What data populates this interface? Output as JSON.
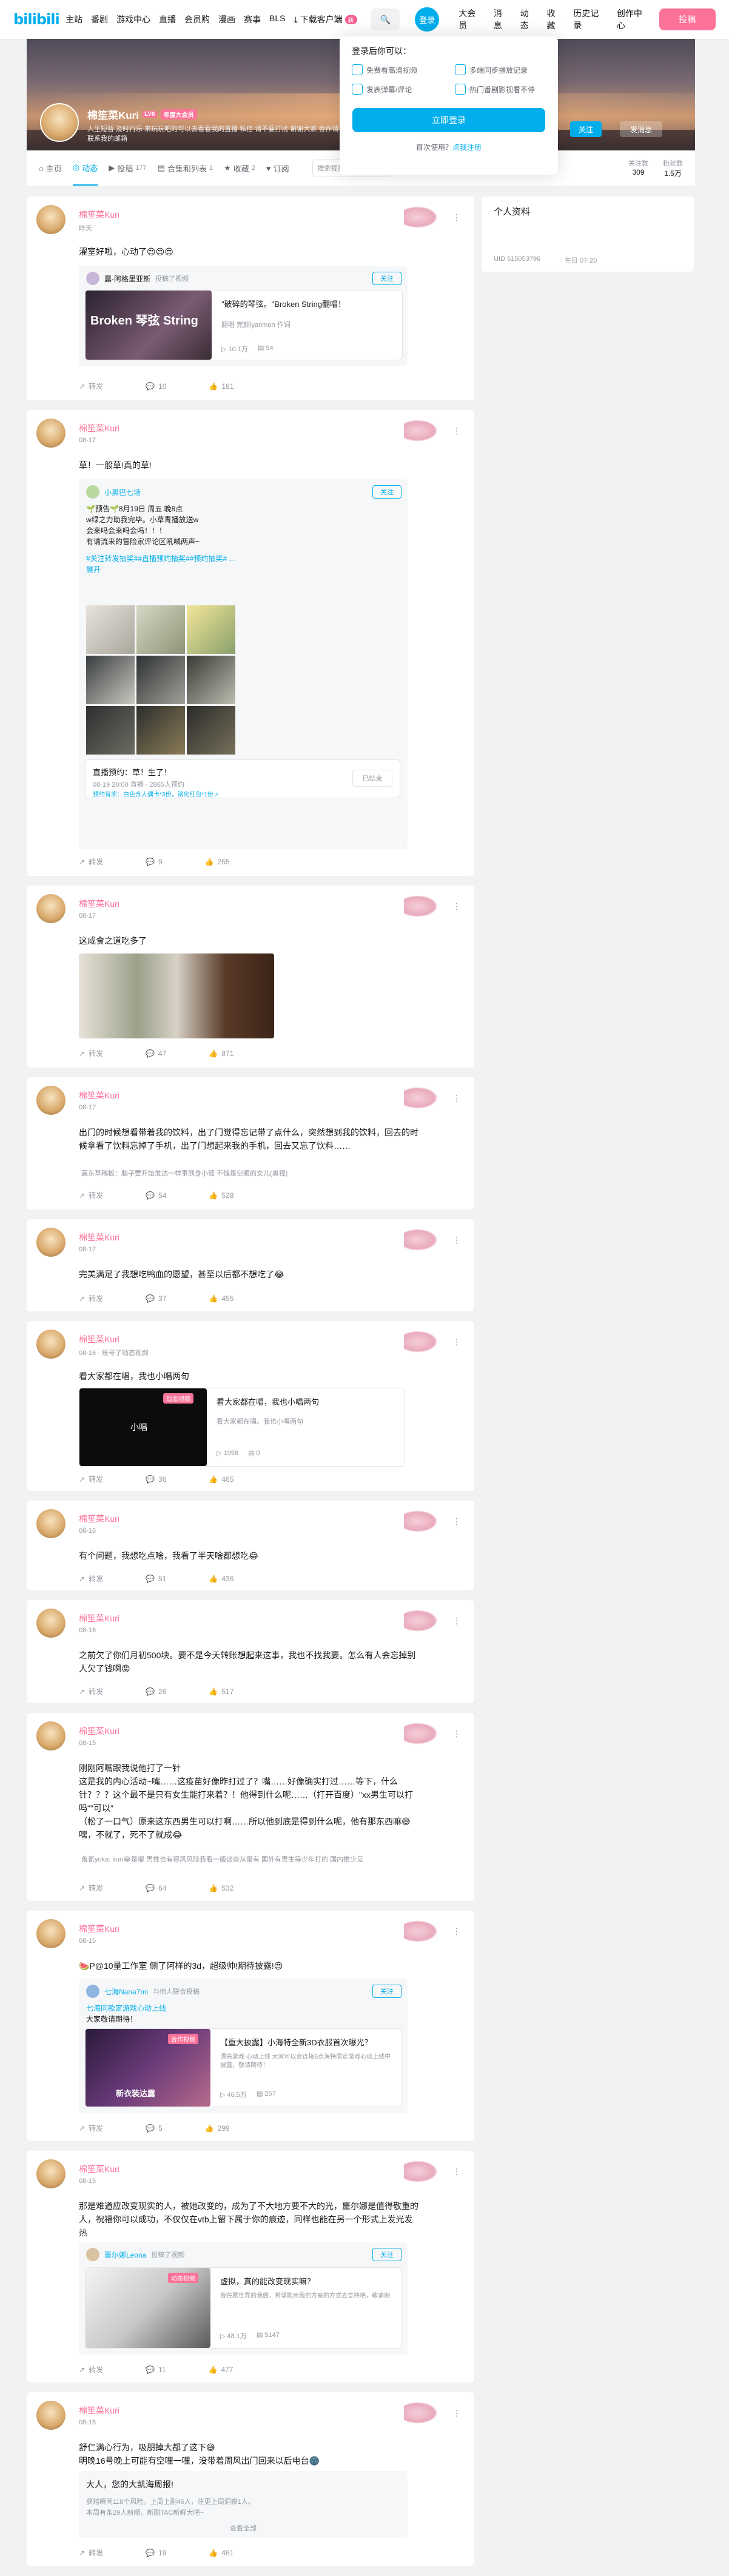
{
  "topbar": {
    "logo": "bilibili",
    "nav": [
      "主站",
      "番剧",
      "游戏中心",
      "直播",
      "会员购",
      "漫画",
      "赛事",
      "BLS"
    ],
    "download": "下载客户端",
    "download_badge": "新",
    "login": "登录",
    "right_nav": [
      "大会员",
      "消息",
      "动态",
      "收藏",
      "历史记录",
      "创作中心"
    ],
    "upload": "投稿"
  },
  "popup": {
    "title": "登录后你可以：",
    "benefits": [
      "免费看高清视频",
      "多端同步播放记录",
      "发表弹幕/评论",
      "热门番剧影视看不停"
    ],
    "login_button": "立即登录",
    "register_prefix": "首次使用？",
    "register_link": "点我注册"
  },
  "profile": {
    "name": "棉笙菜Kuri",
    "level": "LV6",
    "vip": "年度大会员",
    "sign": "人生短暂 及时行乐 来玩玩吧的可以去看看我的直播 私信 请不要打扰 谢谢大家 合作请联系我的邮箱",
    "follow": "关注",
    "message": "发消息"
  },
  "tabs": [
    {
      "label": "主页",
      "count": ""
    },
    {
      "label": "动态",
      "count": ""
    },
    {
      "label": "投稿",
      "count": "177"
    },
    {
      "label": "合集和列表",
      "count": "1"
    },
    {
      "label": "收藏",
      "count": "2"
    },
    {
      "label": "订阅",
      "count": ""
    }
  ],
  "tab_search": "搜索视频、动态",
  "stats": [
    {
      "label": "关注数",
      "value": "309"
    },
    {
      "label": "粉丝数",
      "value": "1.5万"
    }
  ],
  "side": {
    "title": "个人资料",
    "uid_label": "UID",
    "uid": "515053796",
    "birthday_label": "生日",
    "birthday": "07-20"
  },
  "posts": [
    {
      "name": "棉笙菜Kuri",
      "time": "昨天",
      "text": "濯室好啦，心动了😍😍😍",
      "forward": "转发",
      "comment": "10",
      "like": "181",
      "quote": {
        "user": "露-阿格里亚斯",
        "tag": "投稿了视频",
        "follow": "关注",
        "video_title": "\"破碎的琴弦。\"Broken String翻唱！",
        "video_desc": "翻唱 完颜lyanmon 作词",
        "thumb_text": "Broken 琴弦 String",
        "views": "10.1万",
        "danmaku": "94"
      }
    },
    {
      "name": "棉笙菜Kuri",
      "time": "08-17",
      "text": "草！一般草!真的草!",
      "forward": "转发",
      "comment": "9",
      "like": "255",
      "quote": {
        "user": "小黑巴七场",
        "follow": "关注",
        "lines": [
          "🌱预告🌱8月19日 周五 晚8点",
          "w绿之力助我完毕。小草青播放送w",
          "会来吗会来吗会吗！！！",
          "有请流来的冒险家评论区吼喊两声~"
        ],
        "tags": "#关注转发抽奖##直播预约抽奖##预约抽奖# ...",
        "expand": "展开",
        "live_title": "直播预约：草！生了！",
        "live_time": "08-19 20:00 直播 · 2865人预约",
        "live_state": "已结束",
        "lottery": "预约有奖：白色含人偶卡*3份，钢化红包*1份 >"
      }
    },
    {
      "name": "棉笙菜Kuri",
      "time": "08-17",
      "text": "这咸食之道吃多了",
      "forward": "转发",
      "comment": "47",
      "like": "871"
    },
    {
      "name": "棉笙菜Kuri",
      "time": "08-17",
      "text": "出门的时候想看带着我的饮料，出了门觉得忘记带了点什么，突然想到我的饮料，回去的时候拿看了饮料忘掉了手机，出了门想起来我的手机，回去又忘了饮料……",
      "comment_preview": "赢东草稿板：脑子要开始发达一样事到身小瑶 不愧是空眼的女儿(奥视)",
      "forward": "转发",
      "comment": "54",
      "like": "528"
    },
    {
      "name": "棉笙菜Kuri",
      "time": "08-17",
      "text": "完美满足了我想吃鸭血的愿望，甚至以后都不想吃了😂",
      "forward": "转发",
      "comment": "37",
      "like": "455"
    },
    {
      "name": "棉笙菜Kuri",
      "time": "08-16 · 账号了动态视频",
      "text": "看大家都在唱，我也小唱两句",
      "forward": "转发",
      "comment": "36",
      "like": "465",
      "video": {
        "pill": "动态视频",
        "title": "看大家都在唱，我也小唱两句",
        "desc": "看大家都在唱。我也小唱两句",
        "thumb_text": "小唱",
        "views": "1998",
        "danmaku": "0"
      }
    },
    {
      "name": "棉笙菜Kuri",
      "time": "08-16",
      "text": "有个问题，我想吃点啥，我看了半天啥都想吃😂",
      "forward": "转发",
      "comment": "51",
      "like": "436"
    },
    {
      "name": "棉笙菜Kuri",
      "time": "08-16",
      "text": "之前欠了你们月初500块。要不是今天转账想起来这事，我也不找我要。怎么有人会忘掉别人欠了钱啊😡",
      "forward": "转发",
      "comment": "26",
      "like": "517"
    },
    {
      "name": "棉笙菜Kuri",
      "time": "08-15",
      "text": "刚刚阿嘴跟我说他打了一针\n这是我的内心活动~嘴……这疫苗好像昨打过了？嘴……好像确实打过……等下，什么针？？？这个最不是只有女生能打来着？！他得到什么呢……（打开百度）\"xx男生可以打吗\"\"可以\"\n（松了一口气）原来这东西男生可以打啊……所以他到底是得到什么呢，他有那东西嘛😅嘿，不就了，死不了就成😂",
      "comment_preview": "曾氰yoka: kuri😂是嘟 男性也有得风风险我看一般这些从是有 国外有男生等少年打的 国内推少见",
      "forward": "转发",
      "comment": "64",
      "like": "532"
    },
    {
      "name": "棉笙菜Kuri",
      "time": "08-15",
      "text": "🍉P@10量工作室 侧了阿样的3d，超级帅!期待披露!😍",
      "forward": "转发",
      "comment": "5",
      "like": "299",
      "quote": {
        "user": "七海Nana7mi",
        "tag": "与他人联合投稿",
        "follow": "关注",
        "sub": "七海同款定游戏心动上线",
        "sub2": "大家敬请期待！",
        "video_title": "【重大披露】小海特全新3D衣服首次曝光？",
        "video_desc": "漂亮游戏 心动上线 大家可以合连接6点海特限定游戏心动上线中披露，敬请期待！",
        "pill": "合作视频",
        "thumb_text": "新衣装达露",
        "views": "46.5万",
        "danmaku": "257"
      }
    },
    {
      "name": "棉笙菜Kuri",
      "time": "08-15",
      "text": "那是难道应改变现实的人，被她改变的，成为了不大地方要不大的光，噩尔娜是值得敬重的人，祝福你可以成功，不仅仅在vtb上留下属于你的痕迹，同样也能在另一个形式上发光发热",
      "forward": "转发",
      "comment": "11",
      "like": "477",
      "quote": {
        "user": "噩尔娜Leona",
        "tag": "投稿了视频",
        "follow": "关注",
        "video_title": "虚拟，真的能改变现实嘛？",
        "video_desc": "我在愿世界的我做，希望能用我的方案的方式去支持吧，敬请期",
        "pill": "动态视频",
        "views": "48.1万",
        "danmaku": "5147"
      }
    },
    {
      "name": "棉笙菜Kuri",
      "time": "08-15",
      "text": "舒仁满心行为，吸朋掉大都了这下😅\n明晚16号晚上可能有空哩一哩，没带着周风出门回来以后电台🌚",
      "forward": "转发",
      "comment": "19",
      "like": "461",
      "article": {
        "title": "大人，您的大凯海周报!",
        "line1": "获赔瞬间118个风险，上周上剧46人，往更上周洞察1人。",
        "line2": "本周有条29人前期，新剧TAC新鲜大吧~",
        "expand": "查看全部"
      }
    }
  ]
}
